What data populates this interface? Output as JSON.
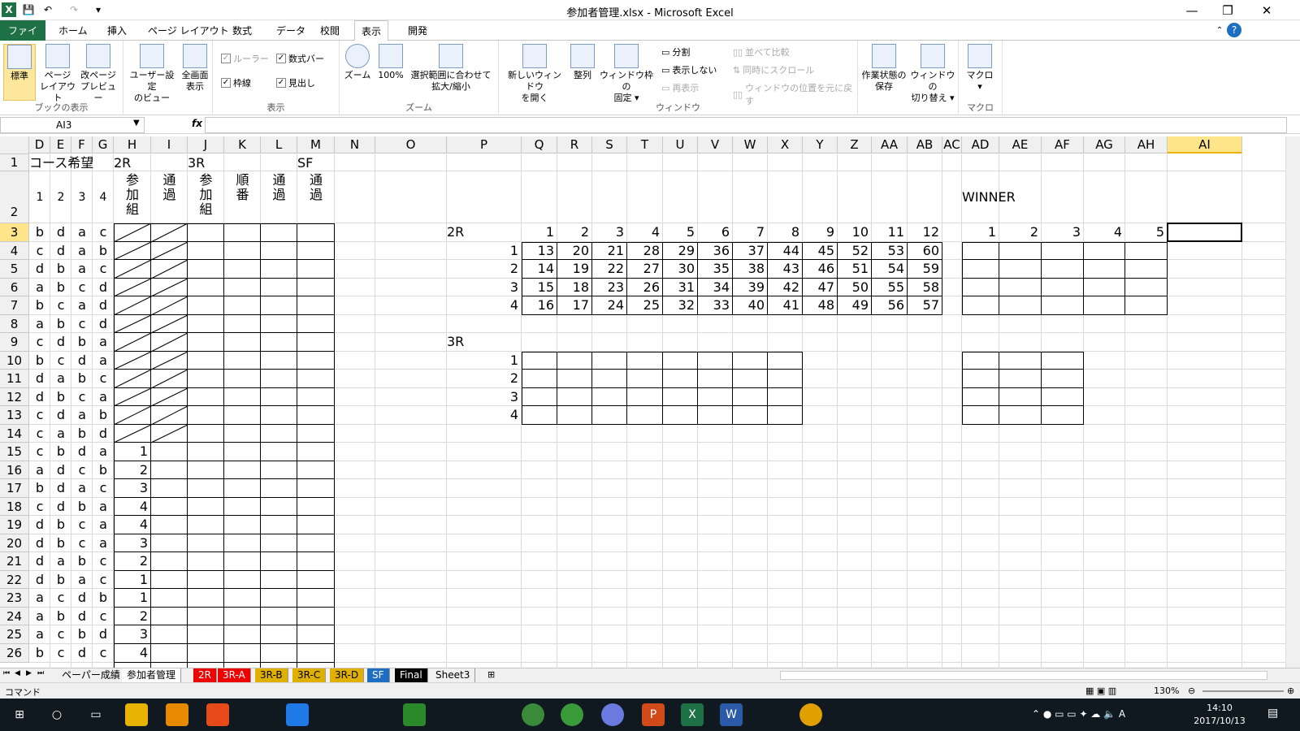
{
  "app": {
    "title": "参加者管理.xlsx - Microsoft Excel",
    "minimize": "—",
    "restore": "❐",
    "close": "✕"
  },
  "tabs": [
    "ファイル",
    "ホーム",
    "挿入",
    "ページ レイアウト",
    "数式",
    "データ",
    "校閲",
    "表示",
    "開発"
  ],
  "ribbon": {
    "groups": {
      "workbook_views": "ブックの表示",
      "show": "表示",
      "zoom": "ズーム",
      "window": "ウィンドウ",
      "macro": "マクロ"
    },
    "normal": "標準",
    "page_layout": "ページ\nレイアウト",
    "page_break": "改ページ\nプレビュー",
    "custom_views": "ユーザー設定\nのビュー",
    "full_screen": "全画面\n表示",
    "ruler": "ルーラー",
    "formula_bar": "数式バー",
    "gridlines": "枠線",
    "headings": "見出し",
    "zoom_btn": "ズーム",
    "zoom100": "100%",
    "zoom_sel": "選択範囲に合わせて\n拡大/縮小",
    "new_window": "新しいウィンドウ\nを開く",
    "arrange": "整列",
    "freeze": "ウィンドウ枠の\n固定 ▾",
    "split": "分割",
    "hide": "表示しない",
    "unhide": "再表示",
    "side_by_side": "並べて比較",
    "sync_scroll": "同時にスクロール",
    "reset_pos": "ウィンドウの位置を元に戻す",
    "save_ws": "作業状態の\n保存",
    "switch": "ウィンドウの\n切り替え ▾",
    "macros": "マクロ\n▾"
  },
  "formula": {
    "namebox": "AI3",
    "fx": "fx",
    "value": ""
  },
  "columns": [
    "D",
    "E",
    "F",
    "G",
    "H",
    "I",
    "J",
    "K",
    "L",
    "M",
    "N",
    "O",
    "P",
    "Q",
    "R",
    "S",
    "T",
    "U",
    "V",
    "W",
    "X",
    "Y",
    "Z",
    "AA",
    "AB",
    "AC",
    "AD",
    "AE",
    "AF",
    "AG",
    "AH",
    "AI"
  ],
  "rows": [
    "1",
    "2",
    "3",
    "4",
    "5",
    "6",
    "7",
    "8",
    "9",
    "10",
    "11",
    "12",
    "13",
    "14",
    "15",
    "16",
    "17",
    "18",
    "19",
    "20",
    "21",
    "22",
    "23",
    "24",
    "25",
    "26"
  ],
  "cells": {
    "course_hope": "コース希望",
    "r2": "2R",
    "r3": "3R",
    "sf": "SF",
    "col_nums": [
      "1",
      "2",
      "3",
      "4"
    ],
    "h_sanka": "参加組",
    "h_tsuka": "通過",
    "h_sanka2": "参加組",
    "h_junban": "順番",
    "h_tsuka2": "通過",
    "h_tsuka3": "通過",
    "winner": "WINNER",
    "left": [
      [
        "b",
        "d",
        "a",
        "c",
        ""
      ],
      [
        "c",
        "d",
        "a",
        "b",
        ""
      ],
      [
        "d",
        "b",
        "a",
        "c",
        ""
      ],
      [
        "a",
        "b",
        "c",
        "d",
        ""
      ],
      [
        "b",
        "c",
        "a",
        "d",
        ""
      ],
      [
        "a",
        "b",
        "c",
        "d",
        ""
      ],
      [
        "c",
        "d",
        "b",
        "a",
        ""
      ],
      [
        "b",
        "c",
        "d",
        "a",
        ""
      ],
      [
        "d",
        "a",
        "b",
        "c",
        ""
      ],
      [
        "d",
        "b",
        "c",
        "a",
        ""
      ],
      [
        "c",
        "d",
        "a",
        "b",
        ""
      ],
      [
        "c",
        "a",
        "b",
        "d",
        ""
      ],
      [
        "c",
        "b",
        "d",
        "a",
        "1"
      ],
      [
        "a",
        "d",
        "c",
        "b",
        "2"
      ],
      [
        "b",
        "d",
        "a",
        "c",
        "3"
      ],
      [
        "c",
        "d",
        "b",
        "a",
        "4"
      ],
      [
        "d",
        "b",
        "c",
        "a",
        "4"
      ],
      [
        "d",
        "b",
        "c",
        "a",
        "3"
      ],
      [
        "d",
        "a",
        "b",
        "c",
        "2"
      ],
      [
        "d",
        "b",
        "a",
        "c",
        "1"
      ],
      [
        "a",
        "c",
        "d",
        "b",
        "1"
      ],
      [
        "a",
        "b",
        "d",
        "c",
        "2"
      ],
      [
        "a",
        "c",
        "b",
        "d",
        "3"
      ],
      [
        "b",
        "c",
        "d",
        "c",
        "4"
      ]
    ],
    "r2_label": "2R",
    "r3_label": "3R",
    "r2_head": [
      "1",
      "2",
      "3",
      "4",
      "5",
      "6",
      "7",
      "8",
      "9",
      "10",
      "11",
      "12"
    ],
    "r2_rows": [
      "1",
      "2",
      "3",
      "4"
    ],
    "r2_data": [
      [
        "13",
        "20",
        "21",
        "28",
        "29",
        "36",
        "37",
        "44",
        "45",
        "52",
        "53",
        "60"
      ],
      [
        "14",
        "19",
        "22",
        "27",
        "30",
        "35",
        "38",
        "43",
        "46",
        "51",
        "54",
        "59"
      ],
      [
        "15",
        "18",
        "23",
        "26",
        "31",
        "34",
        "39",
        "42",
        "47",
        "50",
        "55",
        "58"
      ],
      [
        "16",
        "17",
        "24",
        "25",
        "32",
        "33",
        "40",
        "41",
        "48",
        "49",
        "56",
        "57"
      ]
    ],
    "r3_rows": [
      "1",
      "2",
      "3",
      "4"
    ],
    "winner_head": [
      "1",
      "2",
      "3",
      "4",
      "5"
    ]
  },
  "sheets": [
    "ペーパー成績",
    "参加者管理",
    "2R",
    "3R-A",
    "3R-B",
    "3R-C",
    "3R-D",
    "SF",
    "Final",
    "Sheet3"
  ],
  "status": {
    "mode": "コマンド",
    "zoom": "130%"
  },
  "clock": {
    "time": "14:10",
    "date": "2017/10/13"
  }
}
